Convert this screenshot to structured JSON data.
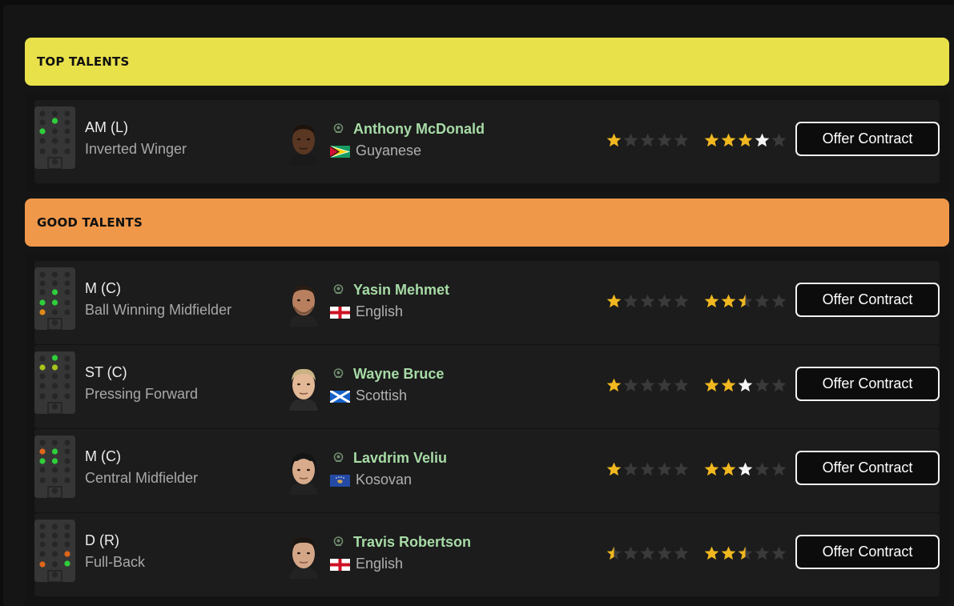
{
  "sections": [
    {
      "title": "TOP TALENTS",
      "color": "#e9e14a",
      "players": [
        {
          "position": "AM (L)",
          "role": "Inverted Winger",
          "name": "Anthony McDonald",
          "nationality": "Guyanese",
          "flag": "guyana-flag",
          "current_ability_stars": 1,
          "potential_ability_stars": 4,
          "offer_label": "Offer Contract"
        }
      ]
    },
    {
      "title": "GOOD TALENTS",
      "color": "#ef984a",
      "players": [
        {
          "position": "M (C)",
          "role": "Ball Winning Midfielder",
          "name": "Yasin Mehmet",
          "nationality": "English",
          "flag": "england-flag",
          "current_ability_stars": 1,
          "potential_ability_stars": 2.5,
          "offer_label": "Offer Contract"
        },
        {
          "position": "ST (C)",
          "role": "Pressing Forward",
          "name": "Wayne Bruce",
          "nationality": "Scottish",
          "flag": "scotland-flag",
          "current_ability_stars": 1,
          "potential_ability_stars": 3,
          "offer_label": "Offer Contract"
        },
        {
          "position": "M (C)",
          "role": "Central Midfielder",
          "name": "Lavdrim Veliu",
          "nationality": "Kosovan",
          "flag": "kosovo-flag",
          "current_ability_stars": 1,
          "potential_ability_stars": 3,
          "offer_label": "Offer Contract"
        },
        {
          "position": "D (R)",
          "role": "Full-Back",
          "name": "Travis Robertson",
          "nationality": "English",
          "flag": "england-flag",
          "current_ability_stars": 0.5,
          "potential_ability_stars": 2.5,
          "offer_label": "Offer Contract"
        }
      ]
    }
  ],
  "colors": {
    "star_gold": "#f1b820",
    "star_white": "#f5f5f5",
    "star_empty": "#3a3a3a",
    "name_green": "#a7dba6"
  }
}
